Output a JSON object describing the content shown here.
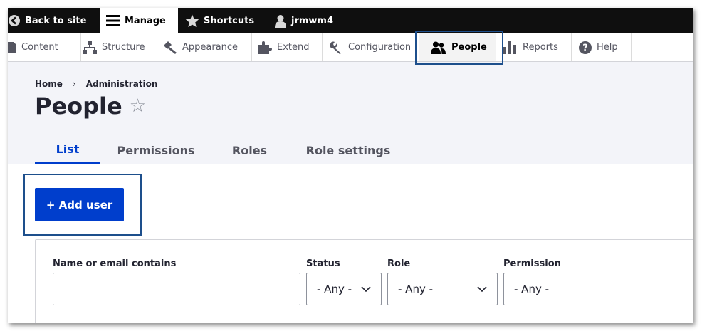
{
  "toolbar": {
    "back": "Back to site",
    "manage": "Manage",
    "shortcuts": "Shortcuts",
    "user": "jrmwm4"
  },
  "tray": {
    "items": [
      {
        "label": "Content",
        "icon": "document-icon"
      },
      {
        "label": "Structure",
        "icon": "sitemap-icon"
      },
      {
        "label": "Appearance",
        "icon": "paintbrush-icon"
      },
      {
        "label": "Extend",
        "icon": "puzzle-icon"
      },
      {
        "label": "Configuration",
        "icon": "wrench-icon"
      },
      {
        "label": "People",
        "icon": "people-icon",
        "active": true
      },
      {
        "label": "Reports",
        "icon": "bar-chart-icon"
      },
      {
        "label": "Help",
        "icon": "help-icon"
      }
    ]
  },
  "breadcrumb": {
    "home": "Home",
    "separator": "›",
    "admin": "Administration"
  },
  "page": {
    "title": "People",
    "star": "☆"
  },
  "tabs": [
    {
      "label": "List",
      "active": true
    },
    {
      "label": "Permissions"
    },
    {
      "label": "Roles"
    },
    {
      "label": "Role settings"
    }
  ],
  "actions": {
    "add_user": "+ Add user"
  },
  "filters": {
    "name_label": "Name or email contains",
    "name_value": "",
    "status_label": "Status",
    "status_value": "- Any -",
    "role_label": "Role",
    "role_value": "- Any -",
    "permission_label": "Permission",
    "permission_value": "- Any -"
  },
  "colors": {
    "toolbar_bg": "#0f0f0f",
    "accent": "#003ecc",
    "header_bg": "#f3f4f9",
    "highlight": "#1d4f8c"
  }
}
